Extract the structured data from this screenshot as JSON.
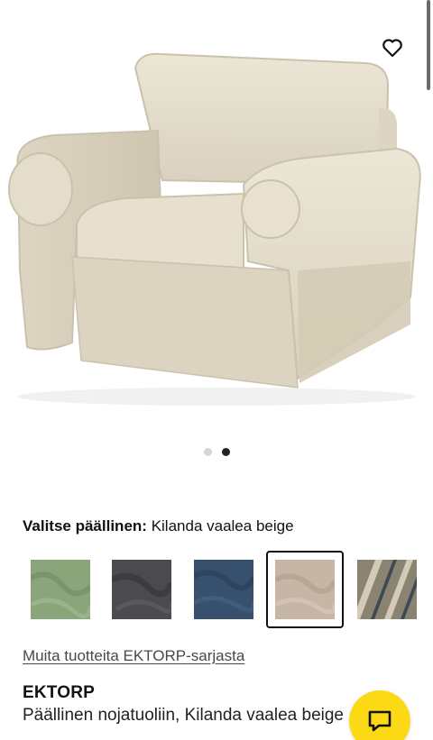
{
  "product": {
    "series": "EKTORP",
    "description": "Päällinen nojatuoliin, Kilanda vaalea beige"
  },
  "gallery": {
    "image_count": 2,
    "active_index": 1,
    "favorite_icon": "heart-outline-icon"
  },
  "cover": {
    "label": "Valitse päällinen:",
    "selected_value": "Kilanda vaalea beige",
    "swatch_colors": [
      "#8aa57a",
      "#4b4b4f",
      "#36506e",
      "#c7b6a6",
      "#8a8371"
    ],
    "selected_index": 3
  },
  "links": {
    "series_more": "Muita tuotteita EKTORP-sarjasta"
  },
  "chat": {
    "icon": "chat-bubble-icon",
    "color": "#fbd914"
  }
}
